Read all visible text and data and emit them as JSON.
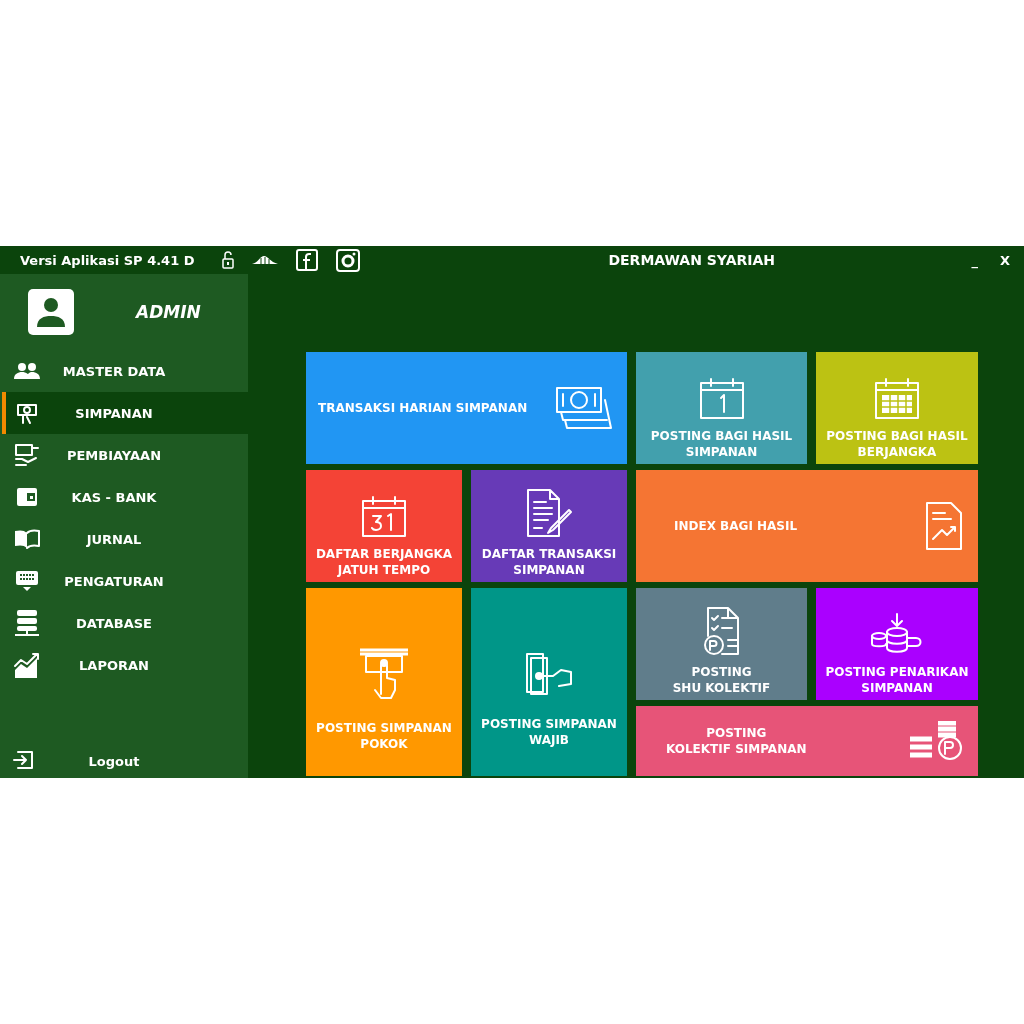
{
  "title_bar": {
    "version": "Versi Aplikasi SP 4.41 D",
    "title": "DERMAWAN SYARIAH",
    "minimize": "_",
    "close": "X"
  },
  "user": {
    "name": "ADMIN"
  },
  "sidebar": {
    "items": [
      {
        "label": "MASTER DATA",
        "selected": false
      },
      {
        "label": "SIMPANAN",
        "selected": true
      },
      {
        "label": "PEMBIAYAAN",
        "selected": false
      },
      {
        "label": "KAS - BANK",
        "selected": false
      },
      {
        "label": "JURNAL",
        "selected": false
      },
      {
        "label": "PENGATURAN",
        "selected": false
      },
      {
        "label": "DATABASE",
        "selected": false
      },
      {
        "label": "LAPORAN",
        "selected": false
      }
    ],
    "logout": "Logout"
  },
  "tiles": [
    {
      "lines": [
        "TRANSAKSI HARIAN SIMPANAN"
      ],
      "kind": "wide",
      "color": "#2196f3"
    },
    {
      "lines": [
        "POSTING BAGI HASIL",
        "SIMPANAN"
      ],
      "kind": "small",
      "color": "#42a0ad"
    },
    {
      "lines": [
        "POSTING BAGI HASIL",
        "BERJANGKA"
      ],
      "kind": "small",
      "color": "#bcc213"
    },
    {
      "lines": [
        "DAFTAR BERJANGKA",
        "JATUH TEMPO"
      ],
      "kind": "small",
      "color": "#f44336"
    },
    {
      "lines": [
        "DAFTAR TRANSAKSI",
        "SIMPANAN"
      ],
      "kind": "small",
      "color": "#673ab7"
    },
    {
      "lines": [
        "INDEX BAGI HASIL"
      ],
      "kind": "wide",
      "color": "#f57533"
    },
    {
      "lines": [
        "POSTING SIMPANAN",
        "POKOK"
      ],
      "kind": "tall",
      "color": "#ff9800"
    },
    {
      "lines": [
        "POSTING SIMPANAN",
        "WAJIB"
      ],
      "kind": "tall",
      "color": "#009688"
    },
    {
      "lines": [
        "POSTING",
        "SHU KOLEKTIF"
      ],
      "kind": "small",
      "color": "#607d8b"
    },
    {
      "lines": [
        "POSTING PENARIKAN",
        "SIMPANAN"
      ],
      "kind": "small",
      "color": "#aa00ff"
    },
    {
      "lines": [
        "POSTING",
        "KOLEKTIF SIMPANAN"
      ],
      "kind": "wide",
      "color": "#e75478"
    }
  ]
}
